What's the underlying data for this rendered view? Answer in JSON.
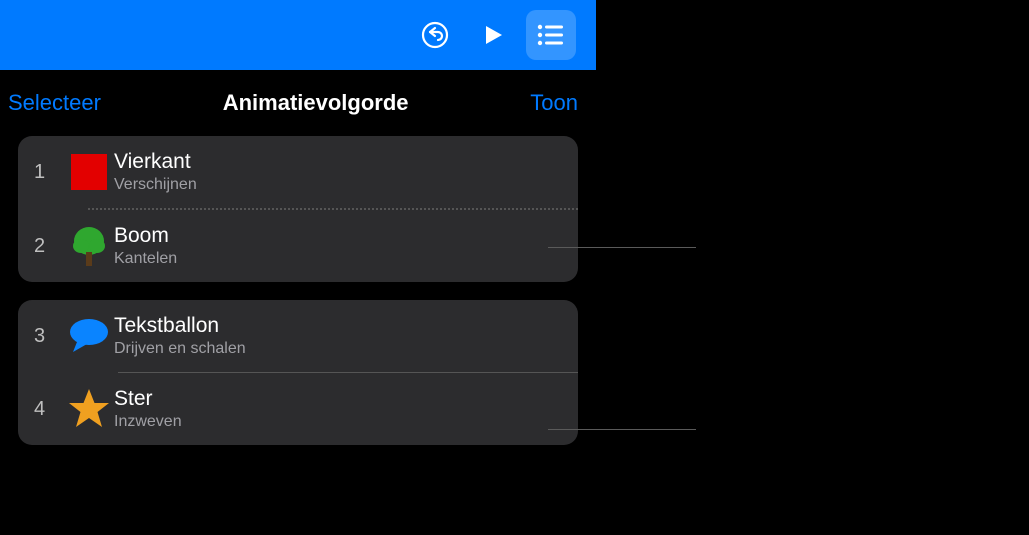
{
  "header": {
    "select_label": "Selecteer",
    "title": "Animatievolgorde",
    "show_label": "Toon"
  },
  "groups": [
    {
      "rows": [
        {
          "num": "1",
          "icon": "square-red",
          "title": "Vierkant",
          "subtitle": "Verschijnen",
          "sep": "none"
        },
        {
          "num": "2",
          "icon": "tree-green",
          "title": "Boom",
          "subtitle": "Kantelen",
          "sep": "dotted"
        }
      ]
    },
    {
      "rows": [
        {
          "num": "3",
          "icon": "speech-blue",
          "title": "Tekstballon",
          "subtitle": "Drijven en schalen",
          "sep": "none"
        },
        {
          "num": "4",
          "icon": "star-orange",
          "title": "Ster",
          "subtitle": "Inzweven",
          "sep": "solid-short"
        }
      ]
    }
  ]
}
